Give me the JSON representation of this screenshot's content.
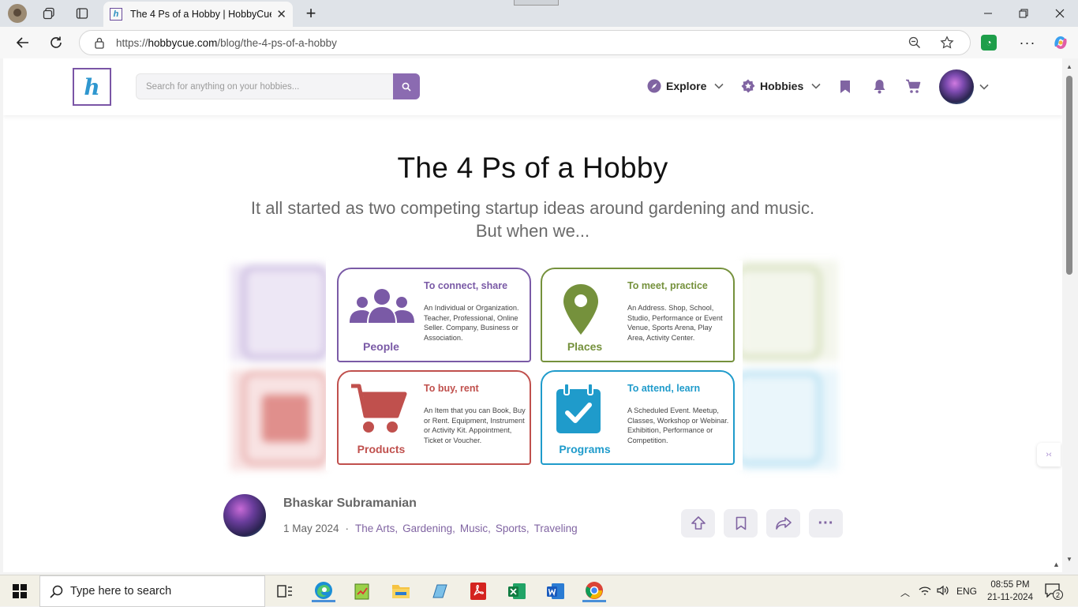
{
  "browser": {
    "tab_title": "The 4 Ps of a Hobby | HobbyCue",
    "url_prefix": "https://",
    "url_domain": "hobbycue.com",
    "url_path": "/blog/the-4-ps-of-a-hobby"
  },
  "site": {
    "search_placeholder": "Search for anything on your hobbies...",
    "nav": {
      "explore": "Explore",
      "hobbies": "Hobbies"
    }
  },
  "article": {
    "title": "The 4 Ps of a Hobby",
    "subtitle": "It all started as two competing startup ideas around gardening and music. But when we...",
    "cards": [
      {
        "name": "People",
        "heading": "To connect, share",
        "text": "An Individual or Organization. Teacher, Professional, Online Seller. Company, Business or Association.",
        "color": "#7a5aa6"
      },
      {
        "name": "Places",
        "heading": "To meet, practice",
        "text": "An Address. Shop, School, Studio, Performance or Event Venue, Sports Arena, Play Area, Activity Center.",
        "color": "#75913c"
      },
      {
        "name": "Products",
        "heading": "To buy, rent",
        "text": "An Item that you can Book, Buy or Rent. Equipment, Instrument or Activity Kit. Appointment, Ticket or Voucher.",
        "color": "#c0504d"
      },
      {
        "name": "Programs",
        "heading": "To attend, learn",
        "text": "A Scheduled Event. Meetup, Classes, Workshop or Webinar. Exhibition, Performance or Competition.",
        "color": "#1f9bcb"
      }
    ],
    "author": "Bhaskar Subramanian",
    "date": "1 May 2024",
    "separator": "·",
    "tags": [
      "The Arts,",
      "Gardening,",
      "Music,",
      "Sports,",
      "Traveling"
    ]
  },
  "taskbar": {
    "search_text": "Type here to search",
    "lang": "ENG",
    "time": "08:55 PM",
    "date": "21-11-2024",
    "notifications": "2"
  }
}
